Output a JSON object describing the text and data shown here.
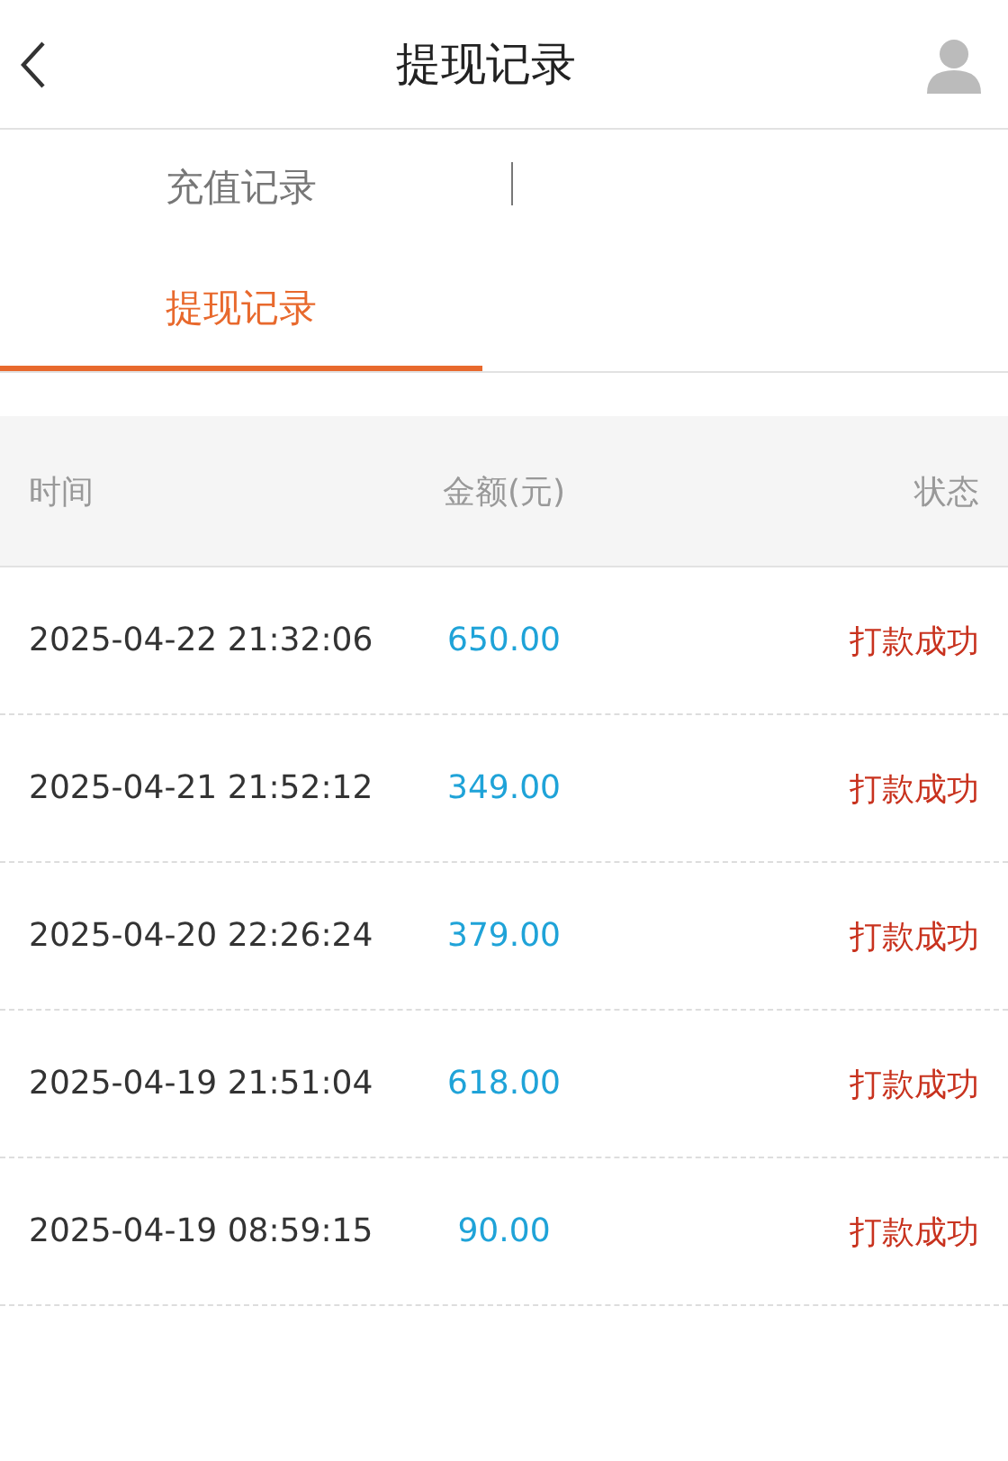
{
  "header": {
    "title": "提现记录"
  },
  "tabs": [
    {
      "label": "充值记录",
      "selected": false
    },
    {
      "label": "提现记录",
      "selected": true
    }
  ],
  "table": {
    "columns": [
      "时间",
      "金额(元)",
      "状态"
    ],
    "rows": [
      {
        "time": "2025-04-22 21:32:06",
        "amount": "650.00",
        "status": "打款成功"
      },
      {
        "time": "2025-04-21 21:52:12",
        "amount": "349.00",
        "status": "打款成功"
      },
      {
        "time": "2025-04-20 22:26:24",
        "amount": "379.00",
        "status": "打款成功"
      },
      {
        "time": "2025-04-19 21:51:04",
        "amount": "618.00",
        "status": "打款成功"
      },
      {
        "time": "2025-04-19 08:59:15",
        "amount": "90.00",
        "status": "打款成功"
      }
    ]
  }
}
